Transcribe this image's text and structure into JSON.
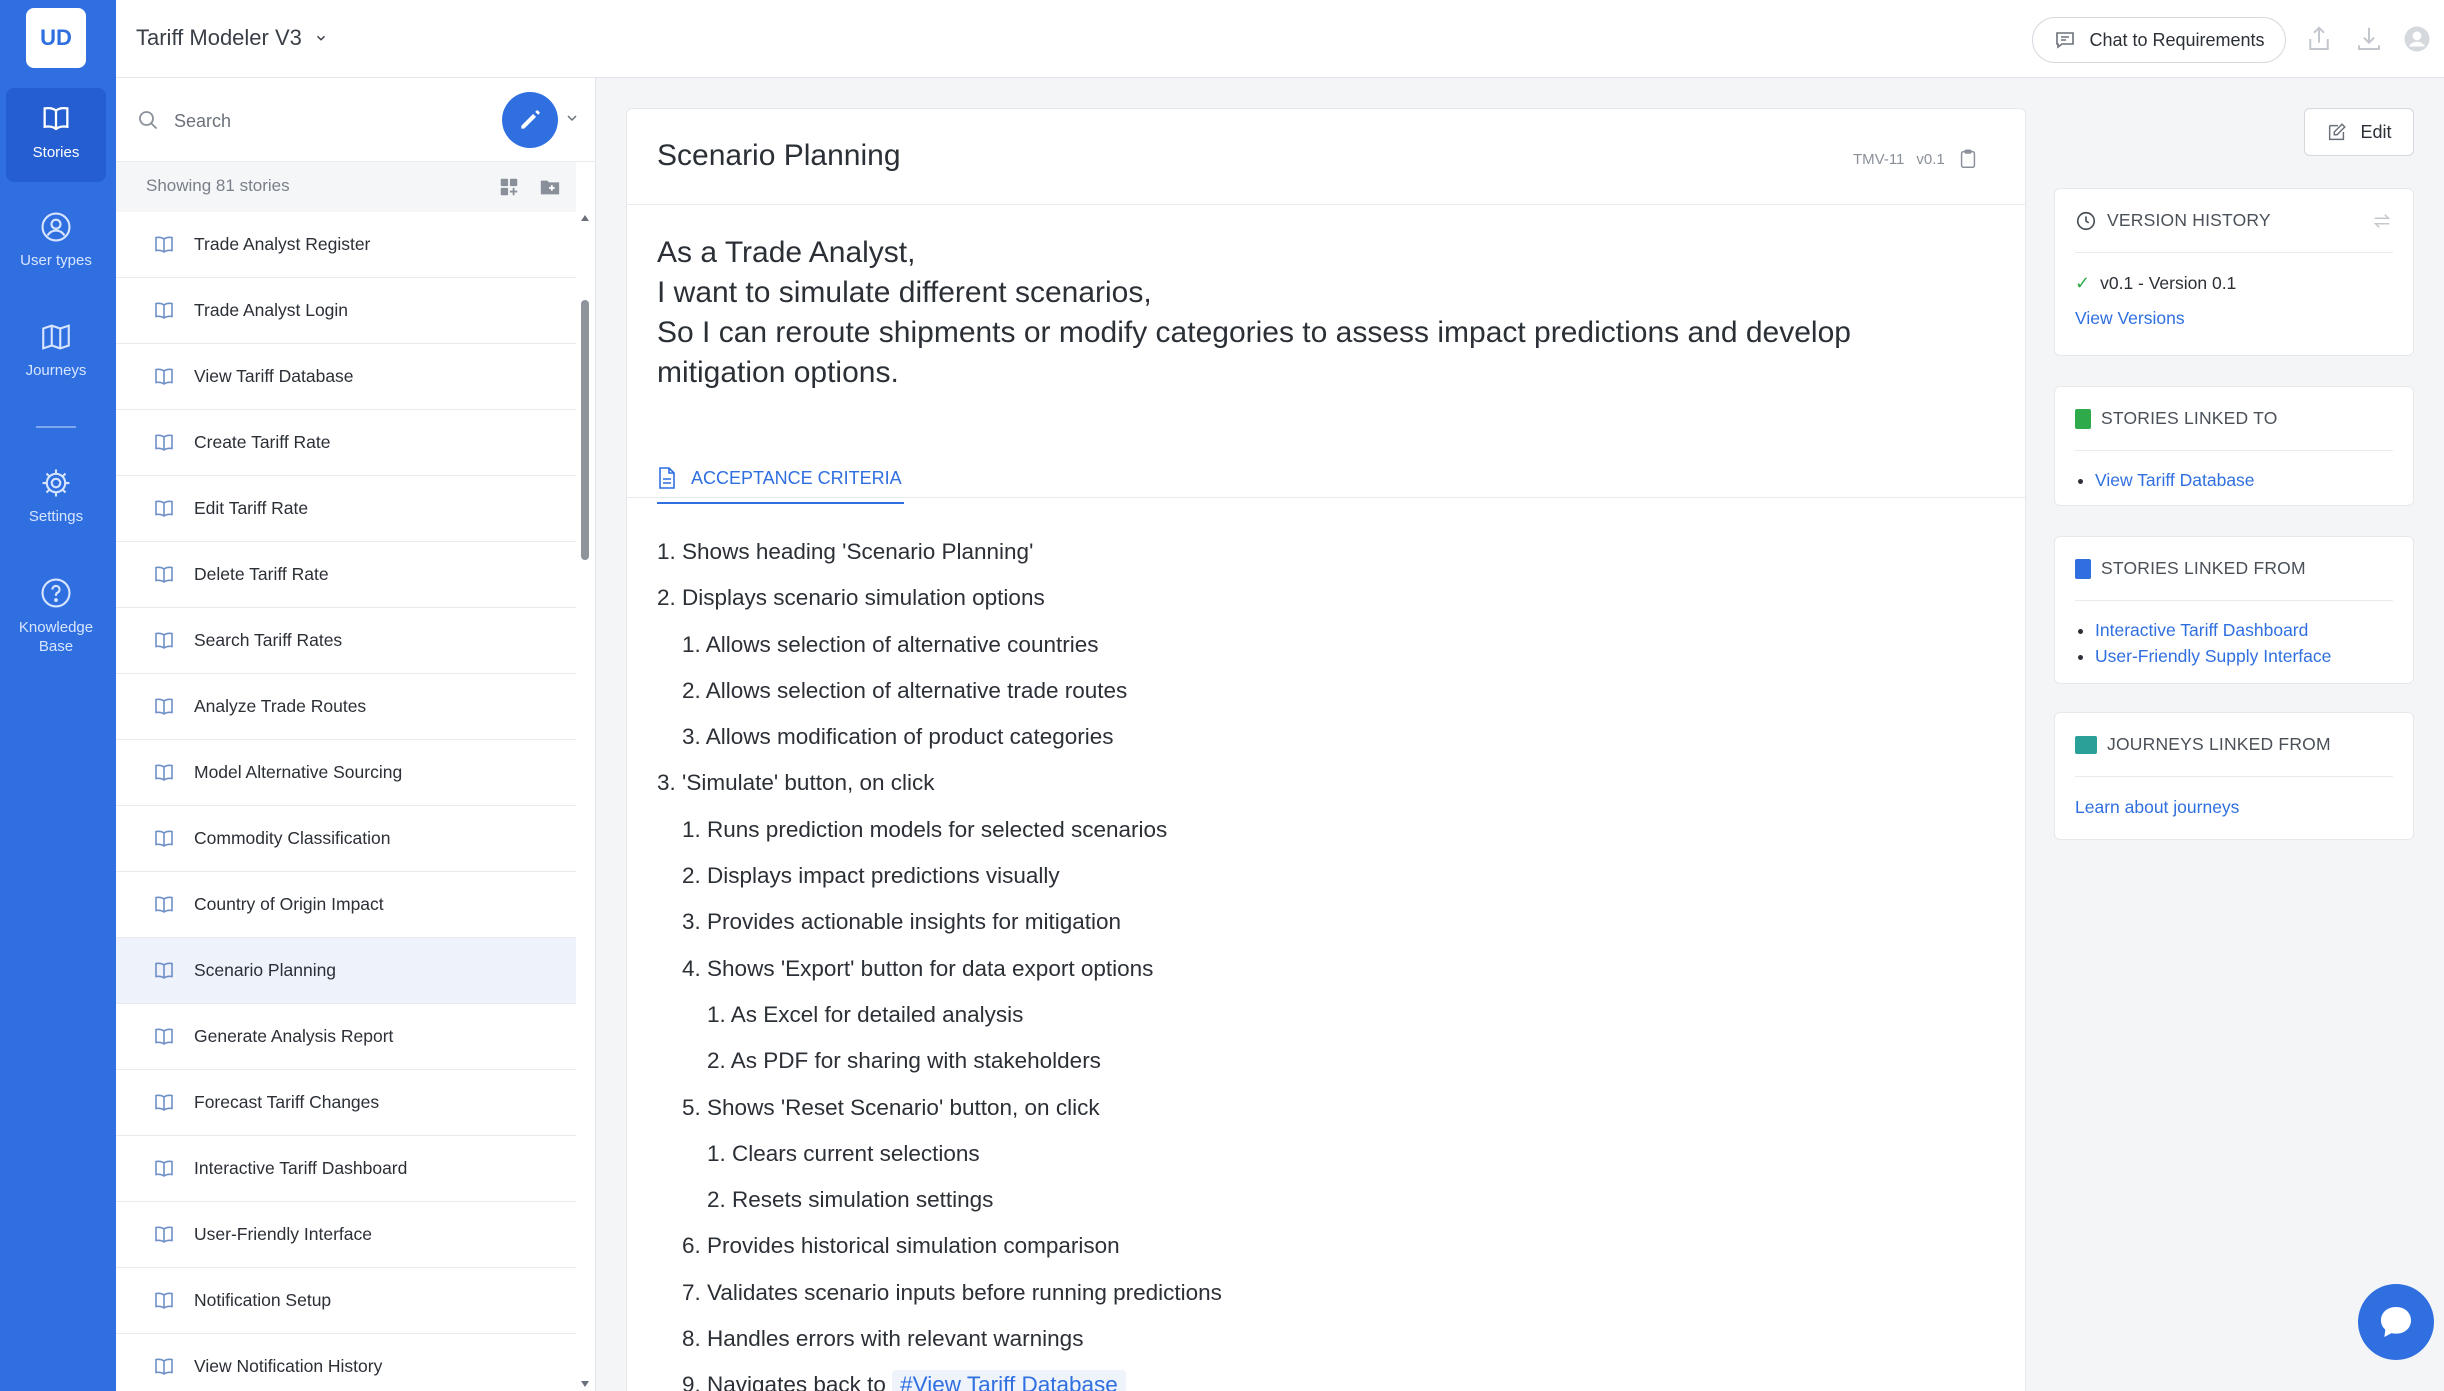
{
  "app": {
    "logo_text": "UD",
    "title": "Tariff Modeler V3"
  },
  "rail": {
    "items": [
      {
        "label": "Stories",
        "icon": "book-icon"
      },
      {
        "label": "User types",
        "icon": "user-circle-icon"
      },
      {
        "label": "Journeys",
        "icon": "map-icon"
      },
      {
        "label": "Settings",
        "icon": "gear-icon"
      },
      {
        "label": "Knowledge Base",
        "icon": "help-icon"
      }
    ]
  },
  "topbar": {
    "chat_label": "Chat to Requirements"
  },
  "list": {
    "search_placeholder": "Search",
    "count_text": "Showing 81 stories",
    "stories": [
      "Trade Analyst Register",
      "Trade Analyst Login",
      "View Tariff Database",
      "Create Tariff Rate",
      "Edit Tariff Rate",
      "Delete Tariff Rate",
      "Search Tariff Rates",
      "Analyze Trade Routes",
      "Model Alternative Sourcing",
      "Commodity Classification",
      "Country of Origin Impact",
      "Scenario Planning",
      "Generate Analysis Report",
      "Forecast Tariff Changes",
      "Interactive Tariff Dashboard",
      "User-Friendly Interface",
      "Notification Setup",
      "View Notification History"
    ],
    "active_index": 11
  },
  "story": {
    "title": "Scenario Planning",
    "id": "TMV-11",
    "version": "v0.1",
    "statement": [
      "As a Trade Analyst,",
      "I want to simulate different scenarios,",
      "So I can reroute shipments or modify categories to assess impact predictions and develop mitigation options."
    ],
    "tab_label": "ACCEPTANCE CRITERIA",
    "criteria": [
      {
        "level": 1,
        "num": "1.",
        "text": "Shows heading 'Scenario Planning'"
      },
      {
        "level": 1,
        "num": "2.",
        "text": "Displays scenario simulation options"
      },
      {
        "level": 2,
        "num": "1.",
        "text": "Allows selection of alternative countries"
      },
      {
        "level": 2,
        "num": "2.",
        "text": "Allows selection of alternative trade routes"
      },
      {
        "level": 2,
        "num": "3.",
        "text": "Allows modification of product categories"
      },
      {
        "level": 1,
        "num": "3.",
        "text": "'Simulate' button, on click"
      },
      {
        "level": 2,
        "num": "1.",
        "text": "Runs prediction models for selected scenarios"
      },
      {
        "level": 2,
        "num": "2.",
        "text": "Displays impact predictions visually"
      },
      {
        "level": 2,
        "num": "3.",
        "text": "Provides actionable insights for mitigation"
      },
      {
        "level": 2,
        "num": "4.",
        "text": "Shows 'Export' button for data export options"
      },
      {
        "level": 3,
        "num": "1.",
        "text": "As Excel for detailed analysis"
      },
      {
        "level": 3,
        "num": "2.",
        "text": "As PDF for sharing with stakeholders"
      },
      {
        "level": 2,
        "num": "5.",
        "text": "Shows 'Reset Scenario' button, on click"
      },
      {
        "level": 3,
        "num": "1.",
        "text": "Clears current selections"
      },
      {
        "level": 3,
        "num": "2.",
        "text": "Resets simulation settings"
      },
      {
        "level": 2,
        "num": "6.",
        "text": "Provides historical simulation comparison"
      },
      {
        "level": 2,
        "num": "7.",
        "text": "Validates scenario inputs before running predictions"
      },
      {
        "level": 2,
        "num": "8.",
        "text": "Handles errors with relevant warnings"
      },
      {
        "level": 2,
        "num": "9.",
        "text": "Navigates back to",
        "ref": "#View Tariff Database"
      }
    ]
  },
  "right": {
    "edit_label": "Edit",
    "version_history": {
      "title": "VERSION HISTORY",
      "entry": "v0.1 - Version 0.1",
      "link": "View Versions"
    },
    "linked_to": {
      "title": "STORIES LINKED TO",
      "items": [
        "View Tariff Database"
      ]
    },
    "linked_from": {
      "title": "STORIES LINKED FROM",
      "items": [
        "Interactive Tariff Dashboard",
        "User-Friendly Supply Interface"
      ]
    },
    "journeys": {
      "title": "JOURNEYS LINKED FROM",
      "link": "Learn about journeys"
    }
  },
  "colors": {
    "brand": "#2f6fe0",
    "active_row": "#edf2fb",
    "green_tag": "#2faa4a",
    "blue_tag": "#2f6fe0",
    "teal_tag": "#2aa198"
  }
}
